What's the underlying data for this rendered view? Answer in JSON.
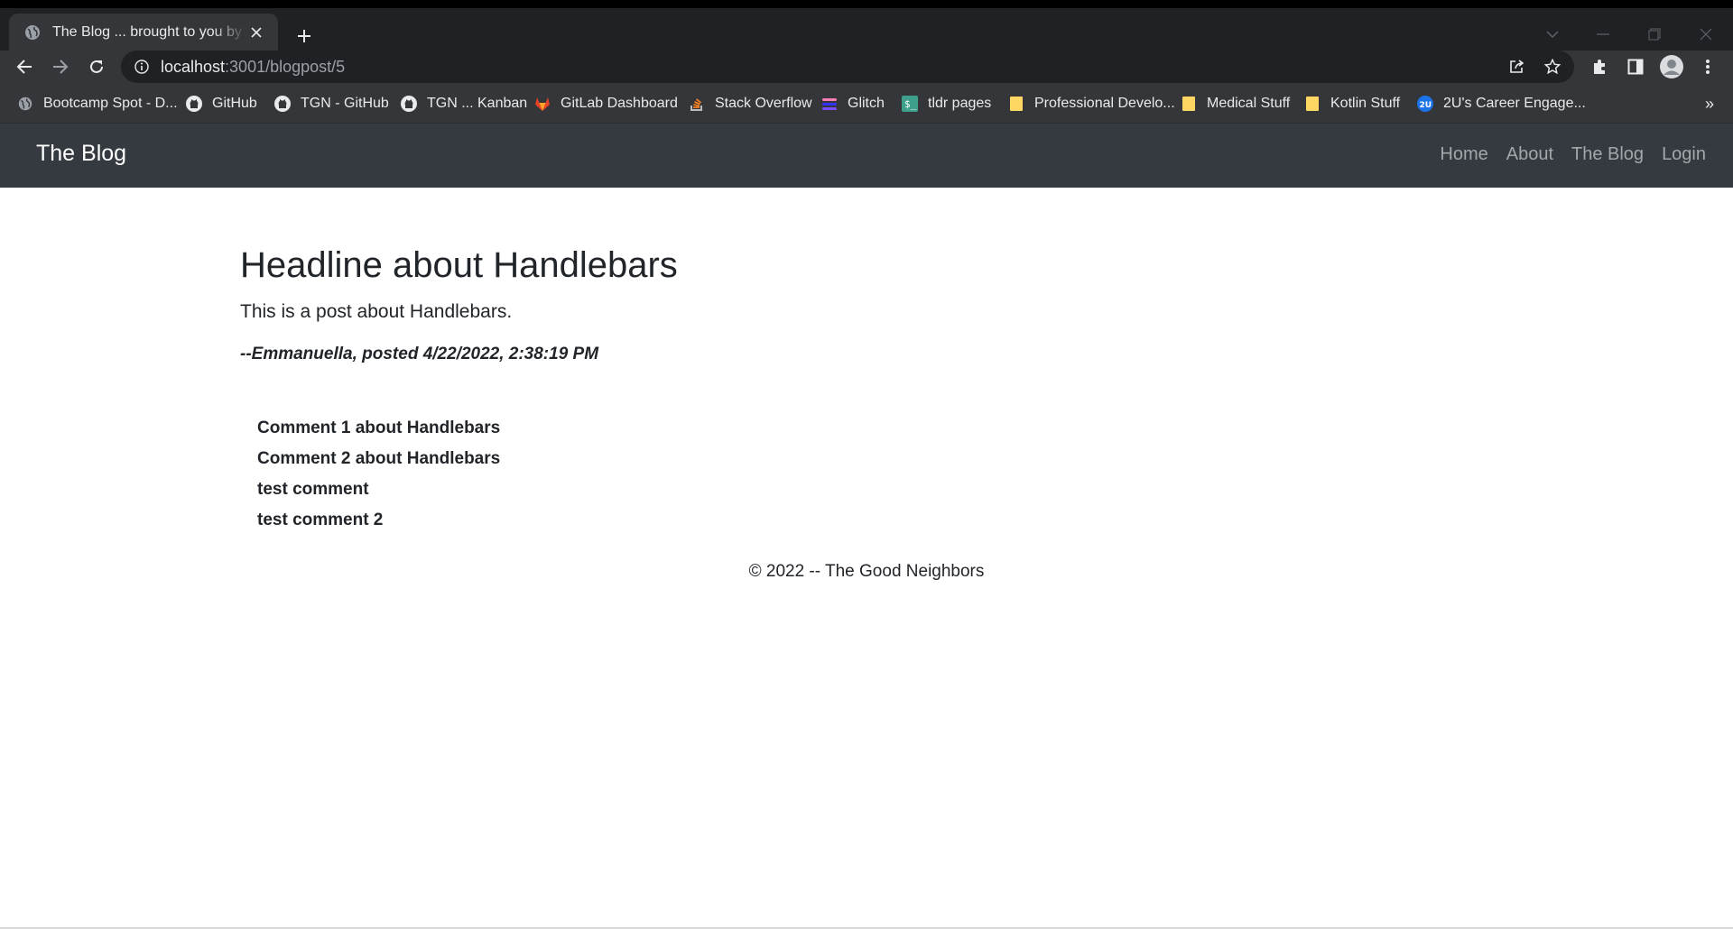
{
  "browser": {
    "tab_title": "The Blog ... brought to you by the Good Neighbors",
    "url_host": "localhost",
    "url_path": ":3001/blogpost/5",
    "bookmarks": [
      {
        "label": "Bootcamp Spot - D...",
        "icon": "globe-icon"
      },
      {
        "label": "GitHub",
        "icon": "github-icon"
      },
      {
        "label": "TGN - GitHub",
        "icon": "github-icon"
      },
      {
        "label": "TGN ... Kanban",
        "icon": "github-icon"
      },
      {
        "label": "GitLab Dashboard",
        "icon": "gitlab-icon"
      },
      {
        "label": "Stack Overflow",
        "icon": "stackoverflow-icon"
      },
      {
        "label": "Glitch",
        "icon": "glitch-icon"
      },
      {
        "label": "tldr pages",
        "icon": "terminal-icon"
      },
      {
        "label": "Professional Develo...",
        "icon": "folder-icon"
      },
      {
        "label": "Medical Stuff",
        "icon": "folder-icon"
      },
      {
        "label": "Kotlin Stuff",
        "icon": "folder-icon"
      },
      {
        "label": "2U's Career Engage...",
        "icon": "2u-icon"
      }
    ],
    "bookmarks_overflow": "»",
    "colors": {
      "chrome_dark": "#202124",
      "chrome_bar": "#35363a",
      "folder": "#fdd663"
    }
  },
  "site": {
    "brand": "The Blog",
    "nav": [
      {
        "label": "Home"
      },
      {
        "label": "About"
      },
      {
        "label": "The Blog"
      },
      {
        "label": "Login"
      }
    ],
    "navbar_color": "#343a40"
  },
  "post": {
    "title": "Headline about Handlebars",
    "body": "This is a post about Handlebars.",
    "meta": "--Emmanuella, posted 4/22/2022, 2:38:19 PM",
    "comments": [
      {
        "text": "Comment 1 about Handlebars"
      },
      {
        "text": "Comment 2 about Handlebars"
      },
      {
        "text": "test comment"
      },
      {
        "text": "test comment 2"
      }
    ]
  },
  "footer": {
    "text": "© 2022 -- The Good Neighbors"
  }
}
